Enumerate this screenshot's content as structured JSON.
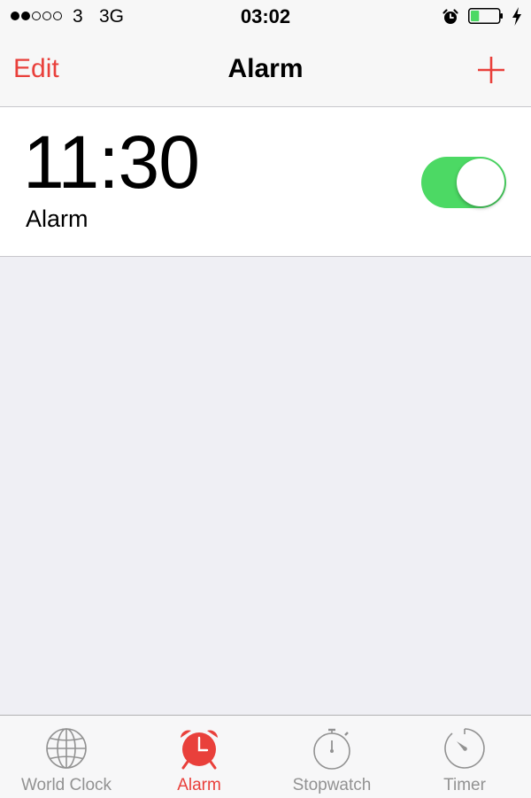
{
  "status_bar": {
    "carrier": "3",
    "network": "3G",
    "time": "03:02",
    "signal_strength_bars": 2,
    "signal_total_bars": 5,
    "battery_level": 0.3,
    "icons": [
      "alarm-clock-icon",
      "battery-icon",
      "charging-bolt-icon"
    ]
  },
  "nav": {
    "edit_label": "Edit",
    "title": "Alarm",
    "add_icon": "plus-icon"
  },
  "alarms": [
    {
      "time": "11:30",
      "label": "Alarm",
      "enabled": true
    }
  ],
  "tab_bar": {
    "active": "alarm",
    "tabs": [
      {
        "id": "world-clock",
        "label": "World Clock",
        "icon": "globe-icon"
      },
      {
        "id": "alarm",
        "label": "Alarm",
        "icon": "alarm-clock-icon"
      },
      {
        "id": "stopwatch",
        "label": "Stopwatch",
        "icon": "stopwatch-icon"
      },
      {
        "id": "timer",
        "label": "Timer",
        "icon": "timer-icon"
      }
    ]
  },
  "colors": {
    "accent": "#e9403b",
    "toggle_on": "#4cd964",
    "battery_fill": "#4cd964",
    "background": "#efeff4",
    "tab_inactive": "#929292"
  }
}
